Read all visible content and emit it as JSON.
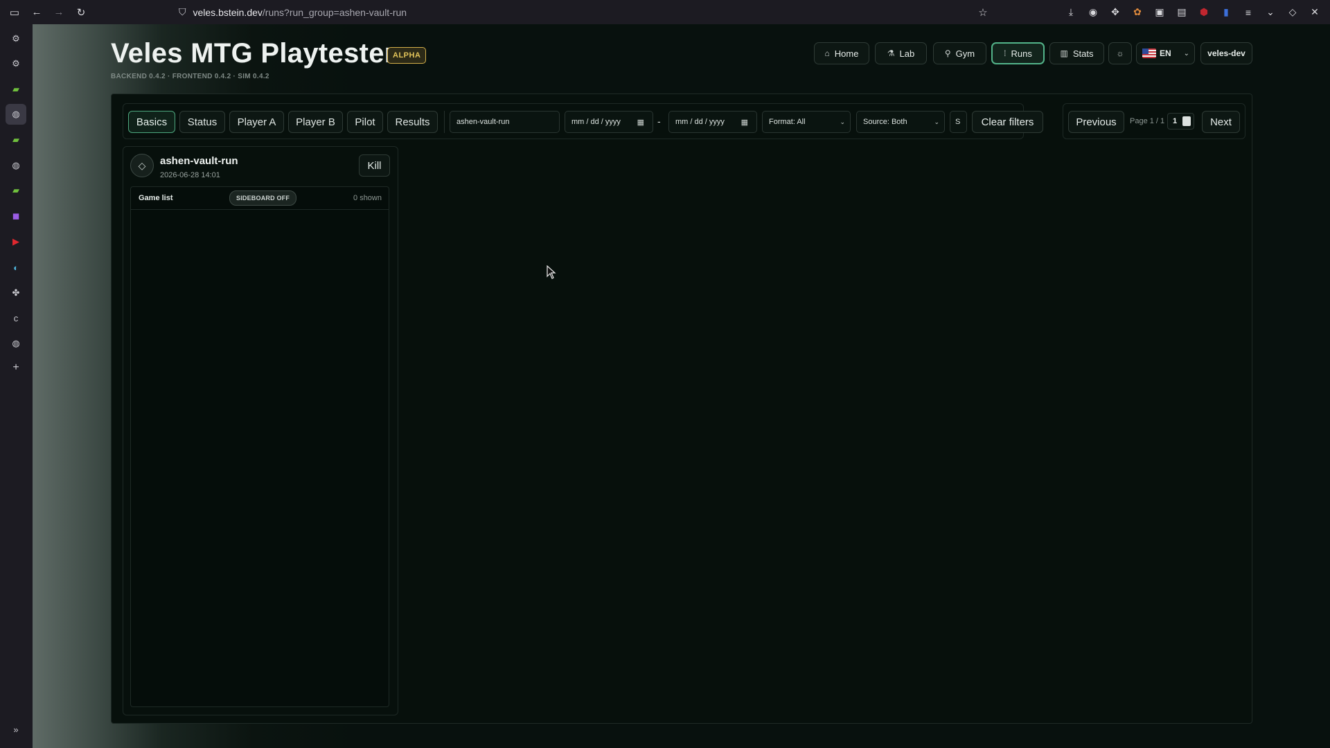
{
  "browser": {
    "url_host": "veles.bstein.dev",
    "url_path": "/runs?run_group=ashen-vault-run"
  },
  "app": {
    "title": "Veles MTG Playtester",
    "badge": "ALPHA",
    "versions": "BACKEND 0.4.2 · FRONTEND 0.4.2 · SIM 0.4.2"
  },
  "nav": {
    "home": "Home",
    "lab": "Lab",
    "gym": "Gym",
    "runs": "Runs",
    "stats": "Stats",
    "language": "EN",
    "user": "veles-dev"
  },
  "filters": {
    "tabs": [
      "Basics",
      "Status",
      "Player A",
      "Player B",
      "Pilot",
      "Results"
    ],
    "search_value": "ashen-vault-run",
    "date_from": "mm / dd / yyyy",
    "date_to": "mm / dd / yyyy",
    "date_sep": "-",
    "format": "Format: All",
    "source": "Source: Both",
    "extra": "S",
    "clear": "Clear filters"
  },
  "pager": {
    "previous": "Previous",
    "label": "Page 1 / 1",
    "value": "1",
    "next": "Next"
  },
  "run": {
    "name": "ashen-vault-run",
    "date": "2026-06-28 14:01",
    "kill": "Kill",
    "game_list_title": "Game list",
    "sideboard_badge": "SIDEBOARD OFF",
    "shown": "0 shown"
  }
}
